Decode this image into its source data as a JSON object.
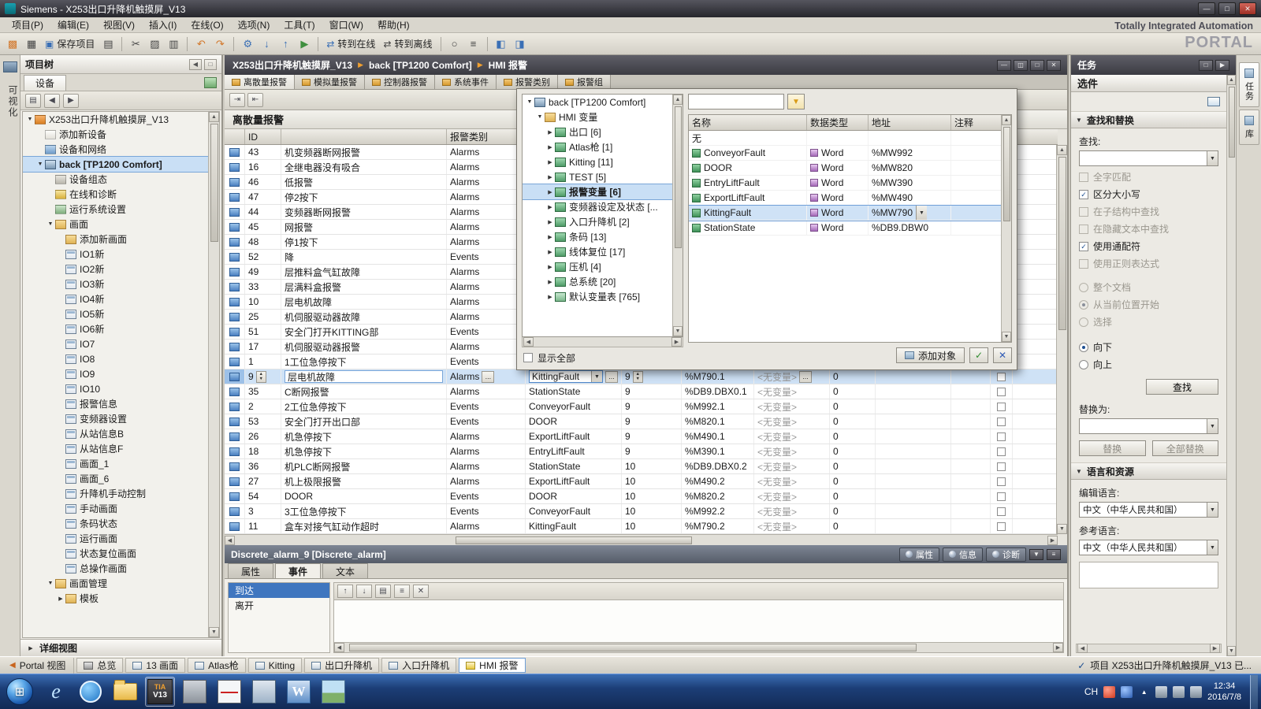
{
  "titlebar": {
    "title": "Siemens  -  X253出口升降机触摸屏_V13"
  },
  "menu": {
    "items": [
      "项目(P)",
      "编辑(E)",
      "视图(V)",
      "插入(I)",
      "在线(O)",
      "选项(N)",
      "工具(T)",
      "窗口(W)",
      "帮助(H)"
    ]
  },
  "toolbar": {
    "save_label": "保存项目",
    "go_online_label": "转到在线",
    "go_offline_label": "转到离线"
  },
  "brand": {
    "line1": "Totally Integrated Automation",
    "line2": "PORTAL"
  },
  "breadcrumb": {
    "segments": [
      "X253出口升降机触摸屏_V13",
      "back [TP1200 Comfort]",
      "HMI 报警"
    ]
  },
  "left_strip": {
    "vertical_label": "可视化"
  },
  "project_tree": {
    "title": "项目树",
    "device_tab": "设备",
    "footer": "详细视图",
    "items": [
      {
        "label": "X253出口升降机触摸屏_V13",
        "level": 0,
        "icon": "project",
        "exp": "down"
      },
      {
        "label": "添加新设备",
        "level": 1,
        "icon": "add"
      },
      {
        "label": "设备和网络",
        "level": 1,
        "icon": "network"
      },
      {
        "label": "back [TP1200 Comfort]",
        "level": 1,
        "icon": "hmi",
        "exp": "down",
        "selected": true
      },
      {
        "label": "设备组态",
        "level": 2,
        "icon": "config"
      },
      {
        "label": "在线和诊断",
        "level": 2,
        "icon": "diag"
      },
      {
        "label": "运行系统设置",
        "level": 2,
        "icon": "runtime"
      },
      {
        "label": "画面",
        "level": 2,
        "icon": "folder",
        "exp": "down"
      },
      {
        "label": "添加新画面",
        "level": 3,
        "icon": "addscreen"
      },
      {
        "label": "IO1新",
        "level": 3,
        "icon": "screen"
      },
      {
        "label": "IO2新",
        "level": 3,
        "icon": "screen"
      },
      {
        "label": "IO3新",
        "level": 3,
        "icon": "screen"
      },
      {
        "label": "IO4新",
        "level": 3,
        "icon": "screen"
      },
      {
        "label": "IO5新",
        "level": 3,
        "icon": "screen"
      },
      {
        "label": "IO6新",
        "level": 3,
        "icon": "screen"
      },
      {
        "label": "IO7",
        "level": 3,
        "icon": "screen"
      },
      {
        "label": "IO8",
        "level": 3,
        "icon": "screen"
      },
      {
        "label": "IO9",
        "level": 3,
        "icon": "screen"
      },
      {
        "label": "IO10",
        "level": 3,
        "icon": "screen"
      },
      {
        "label": "报警信息",
        "level": 3,
        "icon": "screen"
      },
      {
        "label": "变频器设置",
        "level": 3,
        "icon": "screen"
      },
      {
        "label": "从站信息B",
        "level": 3,
        "icon": "screen"
      },
      {
        "label": "从站信息F",
        "level": 3,
        "icon": "screen"
      },
      {
        "label": "画面_1",
        "level": 3,
        "icon": "screen"
      },
      {
        "label": "画面_6",
        "level": 3,
        "icon": "screen"
      },
      {
        "label": "升降机手动控制",
        "level": 3,
        "icon": "screen"
      },
      {
        "label": "手动画面",
        "level": 3,
        "icon": "screen"
      },
      {
        "label": "条码状态",
        "level": 3,
        "icon": "screen"
      },
      {
        "label": "运行画面",
        "level": 3,
        "icon": "screen"
      },
      {
        "label": "状态复位画面",
        "level": 3,
        "icon": "screen"
      },
      {
        "label": "总操作画面",
        "level": 3,
        "icon": "screen"
      },
      {
        "label": "画面管理",
        "level": 2,
        "icon": "folder",
        "exp": "down"
      },
      {
        "label": "模板",
        "level": 3,
        "icon": "folder",
        "exp": "right"
      }
    ]
  },
  "editor": {
    "tabs": [
      "离散量报警",
      "模拟量报警",
      "控制器报警",
      "系统事件",
      "报警类别",
      "报警组"
    ],
    "section_title": "离散量报警",
    "header": {
      "id": "ID",
      "cls": "报警类别"
    },
    "rows": [
      {
        "id": "43",
        "text": "机变频器断网报警",
        "cls": "Alarms"
      },
      {
        "id": "16",
        "text": "全继电器没有吸合",
        "cls": "Alarms"
      },
      {
        "id": "46",
        "text": "低报警",
        "cls": "Alarms"
      },
      {
        "id": "47",
        "text": "停2按下",
        "cls": "Alarms"
      },
      {
        "id": "44",
        "text": "变频器断网报警",
        "cls": "Alarms"
      },
      {
        "id": "45",
        "text": "网报警",
        "cls": "Alarms"
      },
      {
        "id": "48",
        "text": "停1按下",
        "cls": "Alarms"
      },
      {
        "id": "52",
        "text": "降",
        "cls": "Events"
      },
      {
        "id": "49",
        "text": "层推料盒气缸故障",
        "cls": "Alarms"
      },
      {
        "id": "33",
        "text": "层满料盒报警",
        "cls": "Alarms"
      },
      {
        "id": "10",
        "text": "层电机故障",
        "cls": "Alarms"
      },
      {
        "id": "25",
        "text": "机伺服驱动器故障",
        "cls": "Alarms"
      },
      {
        "id": "51",
        "text": "安全门打开KITTING部",
        "cls": "Events"
      },
      {
        "id": "17",
        "text": "机伺服驱动器报警",
        "cls": "Alarms"
      },
      {
        "id": "1",
        "text": "1工位急停按下",
        "cls": "Events"
      },
      {
        "id": "9",
        "text": "层电机故障",
        "cls": "Alarms",
        "var": "KittingFault",
        "bit": "9",
        "addr": "%M790.1",
        "ackvar": "<无变量>",
        "ackbit": "0",
        "selected": true
      },
      {
        "id": "35",
        "text": "C断网报警",
        "cls": "Alarms",
        "var": "StationState",
        "bit": "9",
        "addr": "%DB9.DBX0.1",
        "ackvar": "<无变量>",
        "ackbit": "0"
      },
      {
        "id": "2",
        "text": "2工位急停按下",
        "cls": "Events",
        "var": "ConveyorFault",
        "bit": "9",
        "addr": "%M992.1",
        "ackvar": "<无变量>",
        "ackbit": "0"
      },
      {
        "id": "53",
        "text": "安全门打开出口部",
        "cls": "Events",
        "var": "DOOR",
        "bit": "9",
        "addr": "%M820.1",
        "ackvar": "<无变量>",
        "ackbit": "0"
      },
      {
        "id": "26",
        "text": "机急停按下",
        "cls": "Alarms",
        "var": "ExportLiftFault",
        "bit": "9",
        "addr": "%M490.1",
        "ackvar": "<无变量>",
        "ackbit": "0"
      },
      {
        "id": "18",
        "text": "机急停按下",
        "cls": "Alarms",
        "var": "EntryLiftFault",
        "bit": "9",
        "addr": "%M390.1",
        "ackvar": "<无变量>",
        "ackbit": "0"
      },
      {
        "id": "36",
        "text": "机PLC断网报警",
        "cls": "Alarms",
        "var": "StationState",
        "bit": "10",
        "addr": "%DB9.DBX0.2",
        "ackvar": "<无变量>",
        "ackbit": "0"
      },
      {
        "id": "27",
        "text": "机上极限报警",
        "cls": "Alarms",
        "var": "ExportLiftFault",
        "bit": "10",
        "addr": "%M490.2",
        "ackvar": "<无变量>",
        "ackbit": "0"
      },
      {
        "id": "54",
        "text": "DOOR",
        "cls": "Events",
        "var": "DOOR",
        "bit": "10",
        "addr": "%M820.2",
        "ackvar": "<无变量>",
        "ackbit": "0"
      },
      {
        "id": "3",
        "text": "3工位急停按下",
        "cls": "Events",
        "var": "ConveyorFault",
        "bit": "10",
        "addr": "%M992.2",
        "ackvar": "<无变量>",
        "ackbit": "0"
      },
      {
        "id": "11",
        "text": "盒车对接气缸动作超时",
        "cls": "Alarms",
        "var": "KittingFault",
        "bit": "10",
        "addr": "%M790.2",
        "ackvar": "<无变量>",
        "ackbit": "0"
      }
    ]
  },
  "popup": {
    "tree": [
      {
        "label": "back [TP1200 Comfort]",
        "level": 0,
        "icon": "hmi",
        "exp": "down"
      },
      {
        "label": "HMI 变量",
        "level": 1,
        "icon": "tagfolder",
        "exp": "down"
      },
      {
        "label": "出口 [6]",
        "level": 2,
        "icon": "tagtable",
        "exp": "right"
      },
      {
        "label": "Atlas枪 [1]",
        "level": 2,
        "icon": "tagtable",
        "exp": "right"
      },
      {
        "label": "Kitting [11]",
        "level": 2,
        "icon": "tagtable",
        "exp": "right"
      },
      {
        "label": "TEST [5]",
        "level": 2,
        "icon": "tagtable",
        "exp": "right"
      },
      {
        "label": "报警变量 [6]",
        "level": 2,
        "icon": "tagtable",
        "exp": "right",
        "selected": true
      },
      {
        "label": "变频器设定及状态 [...",
        "level": 2,
        "icon": "tagtable",
        "exp": "right"
      },
      {
        "label": "入口升降机 [2]",
        "level": 2,
        "icon": "tagtable",
        "exp": "right"
      },
      {
        "label": "条码 [13]",
        "level": 2,
        "icon": "tagtable",
        "exp": "right"
      },
      {
        "label": "线体复位 [17]",
        "level": 2,
        "icon": "tagtable",
        "exp": "right"
      },
      {
        "label": "压机 [4]",
        "level": 2,
        "icon": "tagtable",
        "exp": "right"
      },
      {
        "label": "总系统 [20]",
        "level": 2,
        "icon": "tagtable",
        "exp": "right"
      },
      {
        "label": "默认变量表 [765]",
        "level": 2,
        "icon": "tagtable-default",
        "exp": "right"
      }
    ],
    "show_all_label": "显示全部",
    "columns": [
      "名称",
      "数据类型",
      "地址",
      "注释"
    ],
    "rows": [
      {
        "name": "无",
        "type": "",
        "addr": ""
      },
      {
        "name": "ConveyorFault",
        "type": "Word",
        "addr": "%MW992"
      },
      {
        "name": "DOOR",
        "type": "Word",
        "addr": "%MW820"
      },
      {
        "name": "EntryLiftFault",
        "type": "Word",
        "addr": "%MW390"
      },
      {
        "name": "ExportLiftFault",
        "type": "Word",
        "addr": "%MW490"
      },
      {
        "name": "KittingFault",
        "type": "Word",
        "addr": "%MW790",
        "selected": true
      },
      {
        "name": "StationState",
        "type": "Word",
        "addr": "%DB9.DBW0"
      }
    ],
    "add_button": "添加对象"
  },
  "inspector": {
    "title": "Discrete_alarm_9 [Discrete_alarm]",
    "prop_button": "属性",
    "info_button": "信息",
    "diag_button": "诊断",
    "tabs": [
      "属性",
      "事件",
      "文本"
    ],
    "events": [
      "到达",
      "离开"
    ]
  },
  "tasks": {
    "title": "任务",
    "options_header": "选件",
    "find": {
      "header": "查找和替换",
      "find_label": "查找:",
      "options": [
        {
          "label": "全字匹配",
          "checked": false,
          "disabled": true
        },
        {
          "label": "区分大小写",
          "checked": true,
          "disabled": false
        },
        {
          "label": "在子结构中查找",
          "checked": false,
          "disabled": true
        },
        {
          "label": "在隐藏文本中查找",
          "checked": false,
          "disabled": true
        },
        {
          "label": "使用通配符",
          "checked": true,
          "disabled": false
        },
        {
          "label": "使用正则表达式",
          "checked": false,
          "disabled": true
        }
      ],
      "radios": [
        {
          "label": "整个文档",
          "checked": false,
          "disabled": true
        },
        {
          "label": "从当前位置开始",
          "checked": true,
          "disabled": true
        },
        {
          "label": "选择",
          "checked": false,
          "disabled": true
        },
        {
          "label": "向下",
          "checked": true,
          "disabled": false,
          "gap": true
        },
        {
          "label": "向上",
          "checked": false,
          "disabled": false
        }
      ],
      "find_button": "查找",
      "replace_label": "替换为:",
      "replace_button": "替换",
      "replace_all_button": "全部替换"
    },
    "lang": {
      "header": "语言和资源",
      "edit_label": "编辑语言:",
      "edit_value": "中文（中华人民共和国）",
      "ref_label": "参考语言:",
      "ref_value": "中文（中华人民共和国）"
    }
  },
  "right_strip": {
    "tabs": [
      "任务",
      "库"
    ]
  },
  "portal_bar": {
    "portal_view": "Portal 视图",
    "buttons": [
      {
        "label": "总览",
        "icon": "overview"
      },
      {
        "label": "13 画面",
        "icon": "screens"
      },
      {
        "label": "Atlas枪",
        "icon": "screens"
      },
      {
        "label": "Kitting",
        "icon": "screens"
      },
      {
        "label": "出口升降机",
        "icon": "screens"
      },
      {
        "label": "入口升降机",
        "icon": "screens"
      },
      {
        "label": "HMI 报警",
        "icon": "alarm",
        "active": true
      }
    ],
    "status_message": "项目 X253出口升降机触摸屏_V13 已..."
  },
  "taskbar": {
    "tray_lang": "CH",
    "time": "12:34",
    "date": "2016/7/8",
    "ie_letter": "e",
    "word_letter": "W",
    "tia_line1": "TIA",
    "tia_line2": "V13"
  },
  "icons": {
    "minimize": "―",
    "maximize": "□",
    "restore": "❐",
    "close": "✕",
    "split": "◫",
    "breadcrumb_sep": "▶",
    "back_arrow": "◀",
    "expander_open": "▼",
    "expander_closed": "▶",
    "dropdown": "▼",
    "spinner_up": "▲",
    "spinner_down": "▼",
    "ellipsis": "...",
    "check": "✓",
    "up": "↑",
    "down": "↓",
    "left": "◀",
    "right": "▶",
    "grid": "▤",
    "rows": "≡",
    "funnel": "▼",
    "start": "⊞",
    "tray_up": "▲",
    "tb_new": "▩",
    "tb_open": "▦",
    "tb_save": "▣",
    "tb_print": "▤",
    "tb_cut": "✂",
    "tb_copy": "▨",
    "tb_paste": "▥",
    "tb_undo": "↶",
    "tb_redo": "↷",
    "tb_compile": "⚙",
    "tb_download": "↓",
    "tb_upload": "↑",
    "tb_start": "▶",
    "tb_online": "⇄",
    "tb_search": "○",
    "tb_xref": "≡",
    "tb_split_h": "◧",
    "tb_split_v": "◨",
    "tb_insert_r": "⇥",
    "tb_insert_l": "⇤"
  }
}
